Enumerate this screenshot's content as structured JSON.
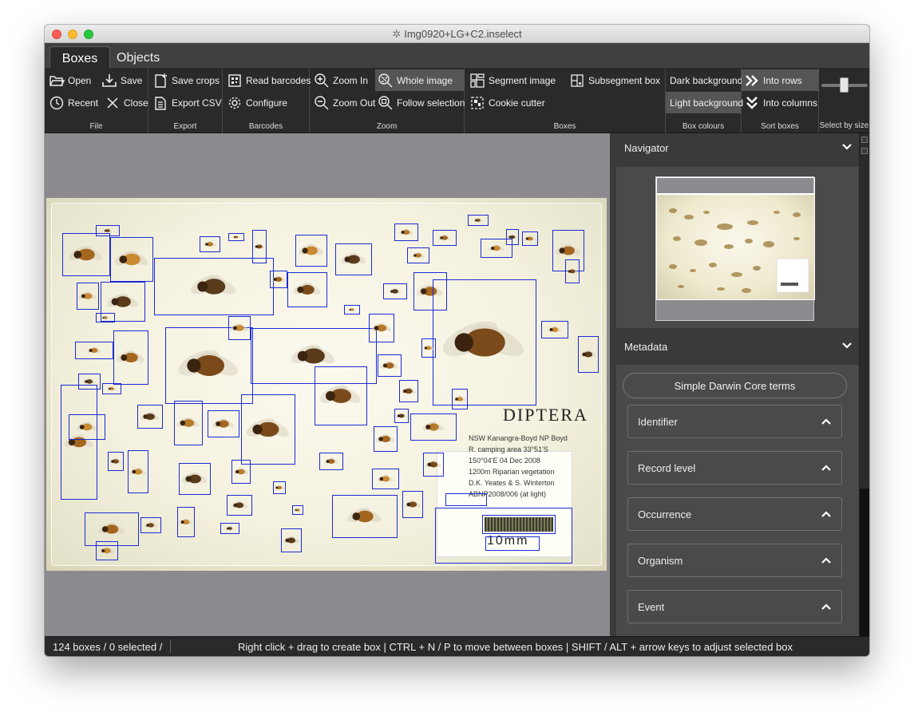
{
  "window": {
    "title": "Img0920+LG+C2.inselect"
  },
  "tabs": [
    {
      "label": "Boxes",
      "active": true
    },
    {
      "label": "Objects",
      "active": false
    }
  ],
  "ribbon": {
    "file": {
      "label": "File",
      "open": "Open",
      "save": "Save",
      "recent": "Recent",
      "close": "Close"
    },
    "export": {
      "label": "Export",
      "save_crops": "Save crops",
      "export_csv": "Export CSV"
    },
    "barcodes": {
      "label": "Barcodes",
      "read": "Read barcodes",
      "configure": "Configure"
    },
    "zoom": {
      "label": "Zoom",
      "zoom_in": "Zoom In",
      "zoom_out": "Zoom Out",
      "whole_image": "Whole image",
      "follow_selection": "Follow selection"
    },
    "boxes": {
      "label": "Boxes",
      "segment_image": "Segment image",
      "subsegment_box": "Subsegment box",
      "cookie_cutter": "Cookie cutter"
    },
    "box_colours": {
      "label": "Box colours",
      "dark": "Dark background",
      "light": "Light background"
    },
    "sort_boxes": {
      "label": "Sort boxes",
      "rows": "Into rows",
      "columns": "Into columns"
    },
    "select_by_size": {
      "label": "Select by size"
    }
  },
  "specimen_label": {
    "heading": "DIPTERA",
    "lines": [
      "NSW Kanangra-Boyd NP Boyd",
      "R. camping area 33°51'S",
      "150°04'E 04 Dec 2008",
      "1200m Riparian vegetation",
      "D.K. Yeates & S. Winterton",
      "ABNP2008/006 (at light)"
    ],
    "scale": "10mm"
  },
  "sidebar": {
    "navigator": {
      "title": "Navigator"
    },
    "metadata": {
      "title": "Metadata",
      "template_button": "Simple Darwin Core terms",
      "sections": [
        "Identifier",
        "Record level",
        "Occurrence",
        "Organism",
        "Event"
      ]
    }
  },
  "status": {
    "count": "124 boxes / 0 selected /",
    "hint": "Right click + drag to create box  |  CTRL + N / P to move between boxes  |  SHIFT / ALT + arrow keys to adjust selected box"
  },
  "colors": {
    "box": "#1b2bd6",
    "ribbon_bg": "#2a2a2a",
    "panel_bg": "#4a4a4a",
    "canvas_bg": "#8b8b8f"
  }
}
